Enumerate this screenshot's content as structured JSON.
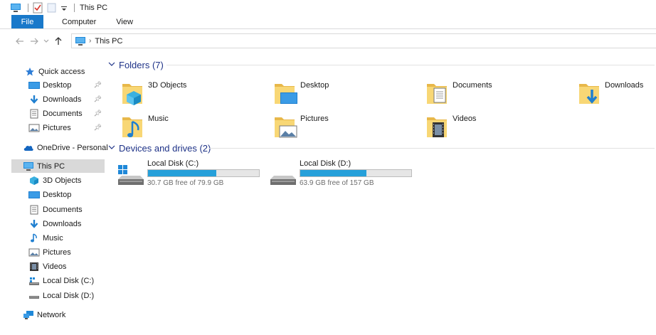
{
  "window": {
    "title": "This PC"
  },
  "ribbon": {
    "file_tab": "File",
    "tabs": [
      "Computer",
      "View"
    ]
  },
  "address": {
    "path": [
      "This PC"
    ]
  },
  "sidebar": {
    "items": [
      {
        "label": "Quick access",
        "pinned": false
      },
      {
        "label": "Desktop",
        "pinned": true
      },
      {
        "label": "Downloads",
        "pinned": true
      },
      {
        "label": "Documents",
        "pinned": true
      },
      {
        "label": "Pictures",
        "pinned": true
      },
      {
        "label": "OneDrive - Personal",
        "pinned": false
      },
      {
        "label": "This PC",
        "pinned": false,
        "selected": true
      },
      {
        "label": "3D Objects"
      },
      {
        "label": "Desktop"
      },
      {
        "label": "Documents"
      },
      {
        "label": "Downloads"
      },
      {
        "label": "Music"
      },
      {
        "label": "Pictures"
      },
      {
        "label": "Videos"
      },
      {
        "label": "Local Disk (C:)"
      },
      {
        "label": "Local Disk (D:)"
      },
      {
        "label": "Network"
      }
    ]
  },
  "folders": {
    "heading": "Folders (7)",
    "items": [
      {
        "label": "3D Objects"
      },
      {
        "label": "Desktop"
      },
      {
        "label": "Documents"
      },
      {
        "label": "Downloads"
      },
      {
        "label": "Music"
      },
      {
        "label": "Pictures"
      },
      {
        "label": "Videos"
      }
    ]
  },
  "devices": {
    "heading": "Devices and drives (2)",
    "items": [
      {
        "label": "Local Disk (C:)",
        "free_text": "30.7 GB free of 79.9 GB",
        "used_fraction": 0.616
      },
      {
        "label": "Local Disk (D:)",
        "free_text": "63.9 GB free of 157 GB",
        "used_fraction": 0.593
      }
    ]
  },
  "colors": {
    "accent": "#1979ca",
    "heading": "#1e3287",
    "drive_bar": "#26a0da",
    "folder": "#f8d775",
    "selected": "#d9d9d9"
  }
}
